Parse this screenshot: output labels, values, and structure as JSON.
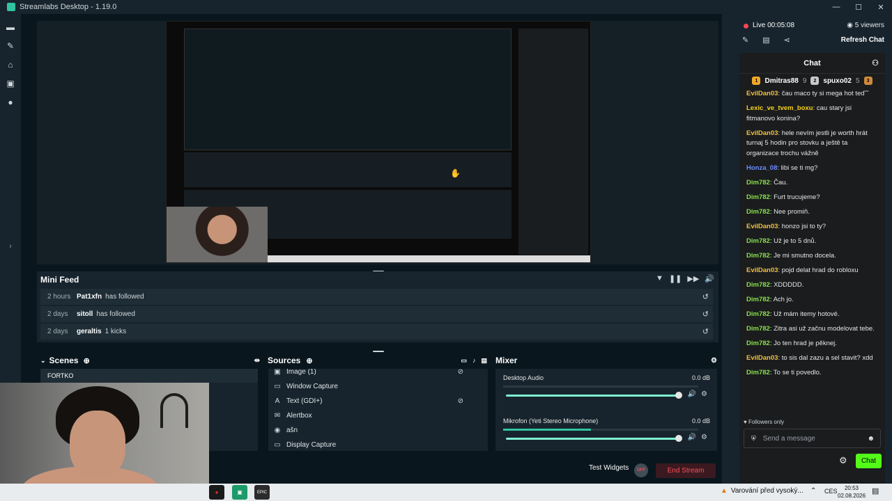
{
  "window": {
    "title": "Streamlabs Desktop - 1.19.0",
    "controls": [
      "—",
      "☐",
      "✕"
    ]
  },
  "nav": {
    "icons": [
      "editor-icon",
      "themes-icon",
      "store-icon",
      "media-icon",
      "record-icon"
    ],
    "glyphs": [
      "▬",
      "✎",
      "⌂",
      "▣",
      "●"
    ]
  },
  "minifeed": {
    "title": "Mini Feed",
    "controls": [
      "▼",
      "❚❚",
      "▶▶",
      "🔊"
    ],
    "rows": [
      {
        "time": "2 hours",
        "name": "Pat1xfn",
        "action": "has followed"
      },
      {
        "time": "2 days",
        "name": "sitoll",
        "action": "has followed"
      },
      {
        "time": "2 days",
        "name": "geraltis",
        "action": "1 kicks"
      }
    ]
  },
  "scenes": {
    "title": "Scenes",
    "items": [
      "FORTKO"
    ]
  },
  "sources": {
    "title": "Sources",
    "items": [
      {
        "label": "Image (1)",
        "icon": "image-icon",
        "glyph": "▣",
        "hidden": true
      },
      {
        "label": "Window Capture",
        "icon": "window-icon",
        "glyph": "▭",
        "hidden": false
      },
      {
        "label": "Text (GDI+)",
        "icon": "text-icon",
        "glyph": "A",
        "hidden": true
      },
      {
        "label": "Alertbox",
        "icon": "alertbox-icon",
        "glyph": "✉",
        "hidden": false
      },
      {
        "label": "ašn",
        "icon": "webcam-icon",
        "glyph": "◉",
        "hidden": false
      },
      {
        "label": "Display Capture",
        "icon": "monitor-icon",
        "glyph": "▭",
        "hidden": false
      }
    ]
  },
  "mixer": {
    "title": "Mixer",
    "channels": [
      {
        "name": "Desktop Audio",
        "db": "0.0 dB",
        "level": 0
      },
      {
        "name": "Mikrofon (Yeti Stereo Microphone)",
        "db": "0.0 dB",
        "level": 0.45
      }
    ]
  },
  "footer": {
    "test_widgets": "Test Widgets",
    "end_stream": "End Stream",
    "off_badge": "OFF"
  },
  "sidebar": {
    "live_label": "Live 00:05:08",
    "viewers": "5 viewers",
    "refresh": "Refresh Chat",
    "chat_title": "Chat",
    "leaders": [
      {
        "rank": "1",
        "name": "Dmitras88",
        "count": "9",
        "color": "#f0a82a"
      },
      {
        "rank": "2",
        "name": "spuxo02",
        "count": "5",
        "color": "#c8c8c8"
      },
      {
        "rank": "3",
        "name": "",
        "count": "",
        "color": "#d08a3a"
      }
    ],
    "messages": [
      {
        "user": "EvilDan03",
        "color": "#f0c040",
        "text": "čau maco ty si mega hot ted˘˘"
      },
      {
        "user": "Lexic_ve_tvem_boxu",
        "color": "#f5d020",
        "text": "cau stary jsi fitmanovo konina?"
      },
      {
        "user": "EvilDan03",
        "color": "#f0c040",
        "text": "hele nevím jestli je worth hrát turnaj 5 hodin pro stovku a ještě ta organizace trochu vážně"
      },
      {
        "user": "Honza_08",
        "color": "#6c8cff",
        "text": "libi se ti mg?"
      },
      {
        "user": "Dim782",
        "color": "#8be04a",
        "text": "Čau."
      },
      {
        "user": "Dim782",
        "color": "#8be04a",
        "text": "Furt trucujeme?"
      },
      {
        "user": "Dim782",
        "color": "#8be04a",
        "text": "Nee promiň."
      },
      {
        "user": "EvilDan03",
        "color": "#f0c040",
        "text": "honzo jsi to ty?"
      },
      {
        "user": "Dim782",
        "color": "#8be04a",
        "text": "Už je to 5 dnů."
      },
      {
        "user": "Dim782",
        "color": "#8be04a",
        "text": "Je mi smutno docela."
      },
      {
        "user": "EvilDan03",
        "color": "#f0c040",
        "text": "pojd delat hrad do robloxu"
      },
      {
        "user": "Dim782",
        "color": "#8be04a",
        "text": "XDDDDD."
      },
      {
        "user": "Dim782",
        "color": "#8be04a",
        "text": "Ach jo."
      },
      {
        "user": "Dim782",
        "color": "#8be04a",
        "text": "Už mám itemy hotové."
      },
      {
        "user": "Dim782",
        "color": "#8be04a",
        "text": "Zitra asi už začnu modelovat tebe."
      },
      {
        "user": "Dim782",
        "color": "#8be04a",
        "text": "Jo ten hrad je pěknej."
      },
      {
        "user": "EvilDan03",
        "color": "#f0c040",
        "text": "to sis dal zazu a sel stavit? xdd"
      },
      {
        "user": "Dim782",
        "color": "#8be04a",
        "text": "To se ti povedlo."
      }
    ],
    "followers_only": "♥ Followers only",
    "input_placeholder": "Send a message",
    "chat_button": "Chat"
  },
  "taskbar": {
    "warning": "Varování před vysoký...",
    "lang": "CES",
    "time": "20:53",
    "date": "02.08.2026",
    "apps": [
      {
        "name": "taskbar-app-1",
        "glyph": "●",
        "bg": "#1a1a1a",
        "fg": "#e03030"
      },
      {
        "name": "taskbar-app-2",
        "glyph": "▣",
        "bg": "#1c9a6a",
        "fg": "#ffffff"
      },
      {
        "name": "taskbar-app-3",
        "glyph": "EPIC",
        "bg": "#2b2b2b",
        "fg": "#ffffff"
      }
    ]
  }
}
